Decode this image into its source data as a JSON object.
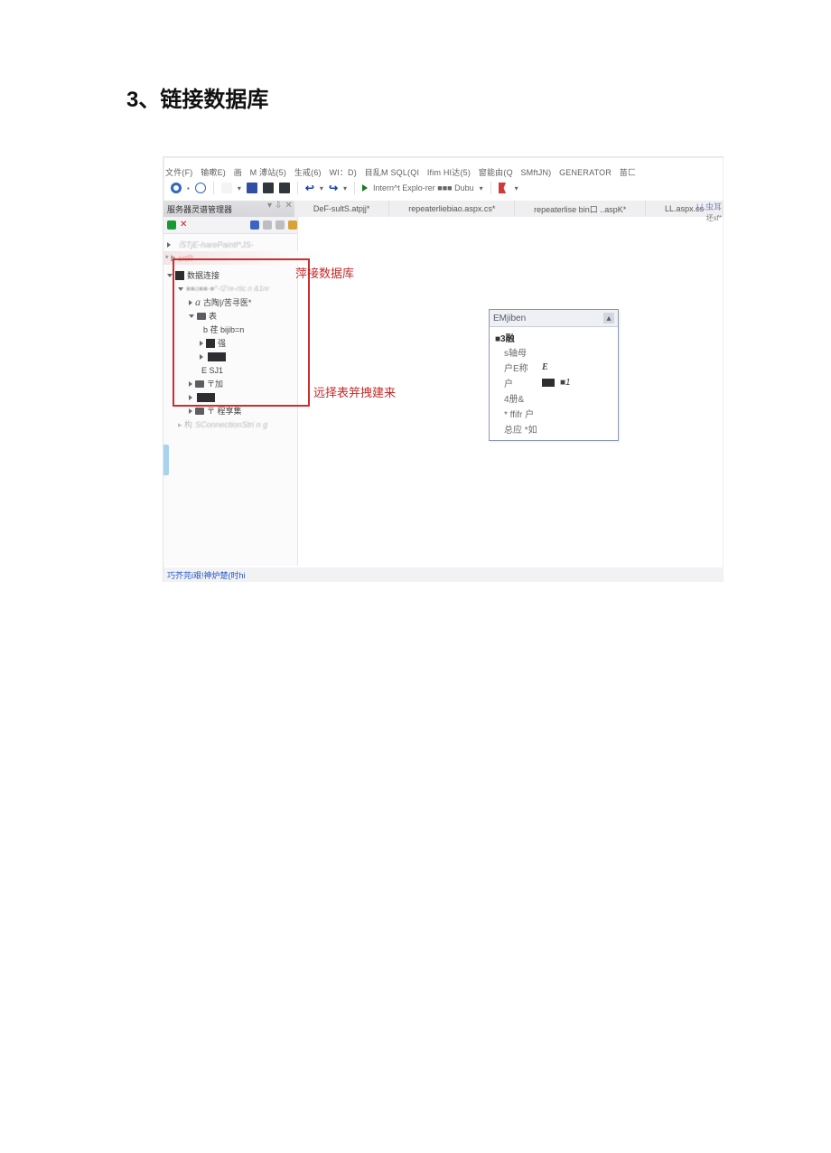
{
  "heading": "3、链接数据库",
  "menubar": [
    "文件(F)",
    "输嗽E)",
    "画",
    "M 溥站(5)",
    "生戒(6)",
    "WI：D)",
    "目乱M SQL(QI",
    "Ifim HI达(5)",
    "窗能由(Q",
    "SMftJN)",
    "GENERATOR",
    "苗匚"
  ],
  "run_label": "Intern^t Explo-rer ■■■ Dubu",
  "explorer_title": "服务器灵谱管理器",
  "tabs": [
    "DeF-sultS.atpjj*",
    "repeaterliebiao.aspx.cs*",
    "repeaterlise bin口 ..aspK*",
    "LL.aspx.cs"
  ],
  "right_label_1": "LL虫耳",
  "right_label_2": "坯xf*",
  "tree": {
    "root_hint": "（5TjE-harePaintl^JS-",
    "b_prefix": "* b",
    "b_suffix_blur": "srtR",
    "conn_node": "数据连接",
    "conn_child_blur": "■■a■■-■^-!2're-rtic n &1nr",
    "a_node": "古陶|/苦寻医*",
    "table_node": "表",
    "row_b": "b 荏 bijib=n",
    "row_qiang": "强",
    "row_e": "E SJ1",
    "row_li": "〒加",
    "row_cz": "〒 程享集",
    "row_conn_str": "SConnectionStri n g",
    "row_conn_prefix": "▸  构"
  },
  "annot1": "萍接数据库",
  "annot2": "远择表笄拽建来",
  "panel": {
    "header": "EMjiben",
    "category": "■3融",
    "rows": [
      {
        "k": "s轴母",
        "v": ""
      },
      {
        "k": "户E称",
        "v": ""
      },
      {
        "k": "户",
        "v": "■1",
        "box": true
      },
      {
        "k": "4册&",
        "v": ""
      },
      {
        "k": "* ffifr 户",
        "v": ""
      },
      {
        "k": "总应 *如",
        "v": ""
      }
    ]
  },
  "status": "巧芥芫i艰!神炉楚(时hi"
}
